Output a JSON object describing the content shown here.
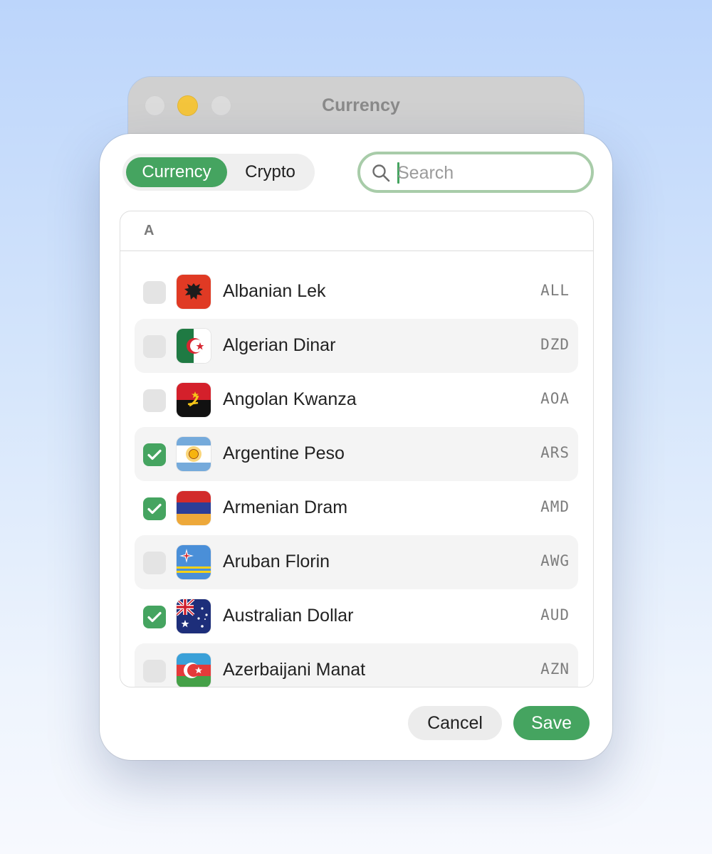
{
  "window": {
    "title": "Currency"
  },
  "segmented": {
    "currency_label": "Currency",
    "crypto_label": "Crypto",
    "selected": "Currency"
  },
  "search": {
    "placeholder": "Search",
    "value": ""
  },
  "section": {
    "letter": "A"
  },
  "items": [
    {
      "name": "Albanian Lek",
      "code": "ALL",
      "checked": false,
      "flag": "albania-flag"
    },
    {
      "name": "Algerian Dinar",
      "code": "DZD",
      "checked": false,
      "flag": "algeria-flag"
    },
    {
      "name": "Angolan Kwanza",
      "code": "AOA",
      "checked": false,
      "flag": "angola-flag"
    },
    {
      "name": "Argentine Peso",
      "code": "ARS",
      "checked": true,
      "flag": "argentina-flag"
    },
    {
      "name": "Armenian Dram",
      "code": "AMD",
      "checked": true,
      "flag": "armenia-flag"
    },
    {
      "name": "Aruban Florin",
      "code": "AWG",
      "checked": false,
      "flag": "aruba-flag"
    },
    {
      "name": "Australian Dollar",
      "code": "AUD",
      "checked": true,
      "flag": "australia-flag"
    },
    {
      "name": "Azerbaijani Manat",
      "code": "AZN",
      "checked": false,
      "flag": "azerbaijan-flag"
    }
  ],
  "footer": {
    "cancel_label": "Cancel",
    "save_label": "Save"
  },
  "colors": {
    "accent": "#45a460",
    "search_focus_ring": "#a8cca9",
    "background_top": "#bcd5fb"
  }
}
